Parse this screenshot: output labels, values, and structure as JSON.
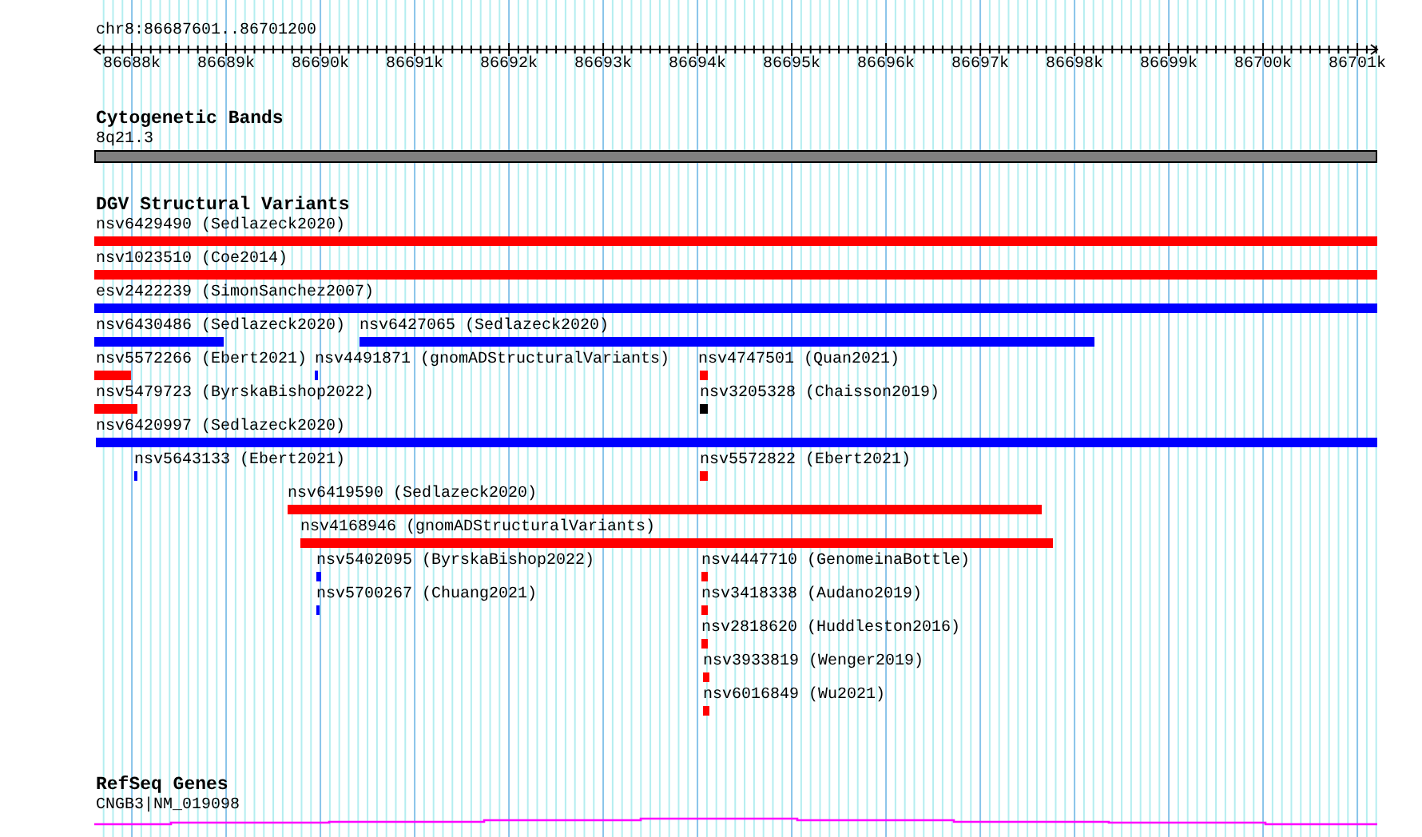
{
  "ruler": {
    "location": "chr8:86687601..86701200",
    "ticks": [
      "86688k",
      "86689k",
      "86690k",
      "86691k",
      "86692k",
      "86693k",
      "86694k",
      "86695k",
      "86696k",
      "86697k",
      "86698k",
      "86699k",
      "86700k",
      "86701k"
    ]
  },
  "tracks": [
    {
      "kind": "cytoband",
      "title": "Cytogenetic Bands",
      "label": "8q21.3"
    },
    {
      "kind": "variants",
      "title": "DGV Structural Variants",
      "rows": [
        [
          {
            "label": "nsv6429490 (Sedlazeck2020)",
            "color": "#ff0000"
          }
        ],
        [
          {
            "label": "nsv1023510 (Coe2014)",
            "color": "#ff0000"
          }
        ],
        [
          {
            "label": "esv2422239 (SimonSanchez2007)",
            "color": "#0000ff"
          }
        ],
        [
          {
            "label": "nsv6430486 (Sedlazeck2020)",
            "color": "#0000ff"
          },
          {
            "label": "nsv6427065 (Sedlazeck2020)",
            "color": "#0000ff"
          }
        ],
        [
          {
            "label": "nsv5572266 (Ebert2021)",
            "color": "#ff0000"
          },
          {
            "label": "nsv4491871 (gnomADStructuralVariants)",
            "color": "#0000ff"
          },
          {
            "label": "nsv4747501 (Quan2021)",
            "color": "#ff0000"
          }
        ],
        [
          {
            "label": "nsv5479723 (ByrskaBishop2022)",
            "color": "#ff0000"
          },
          {
            "label": "nsv3205328 (Chaisson2019)",
            "color": "#000000"
          }
        ],
        [
          {
            "label": "nsv6420997 (Sedlazeck2020)",
            "color": "#0000ff"
          }
        ],
        [
          {
            "label": "nsv5643133 (Ebert2021)",
            "color": "#0000ff"
          },
          {
            "label": "nsv5572822 (Ebert2021)",
            "color": "#ff0000"
          }
        ],
        [
          {
            "label": "nsv6419590 (Sedlazeck2020)",
            "color": "#ff0000"
          }
        ],
        [
          {
            "label": "nsv4168946 (gnomADStructuralVariants)",
            "color": "#ff0000"
          }
        ],
        [
          {
            "label": "nsv5402095 (ByrskaBishop2022)",
            "color": "#0000ff"
          },
          {
            "label": "nsv4447710 (GenomeinaBottle)",
            "color": "#ff0000"
          }
        ],
        [
          {
            "label": "nsv5700267 (Chuang2021)",
            "color": "#0000ff"
          },
          {
            "label": "nsv3418338 (Audano2019)",
            "color": "#ff0000"
          }
        ],
        [
          {
            "label": "nsv2818620 (Huddleston2016)",
            "color": "#ff0000"
          }
        ],
        [
          {
            "label": "nsv3933819 (Wenger2019)",
            "color": "#ff0000"
          }
        ],
        [
          {
            "label": "nsv6016849 (Wu2021)",
            "color": "#ff0000"
          }
        ]
      ]
    },
    {
      "kind": "gene",
      "title": "RefSeq Genes",
      "label": "CNGB3|NM_019098"
    }
  ]
}
